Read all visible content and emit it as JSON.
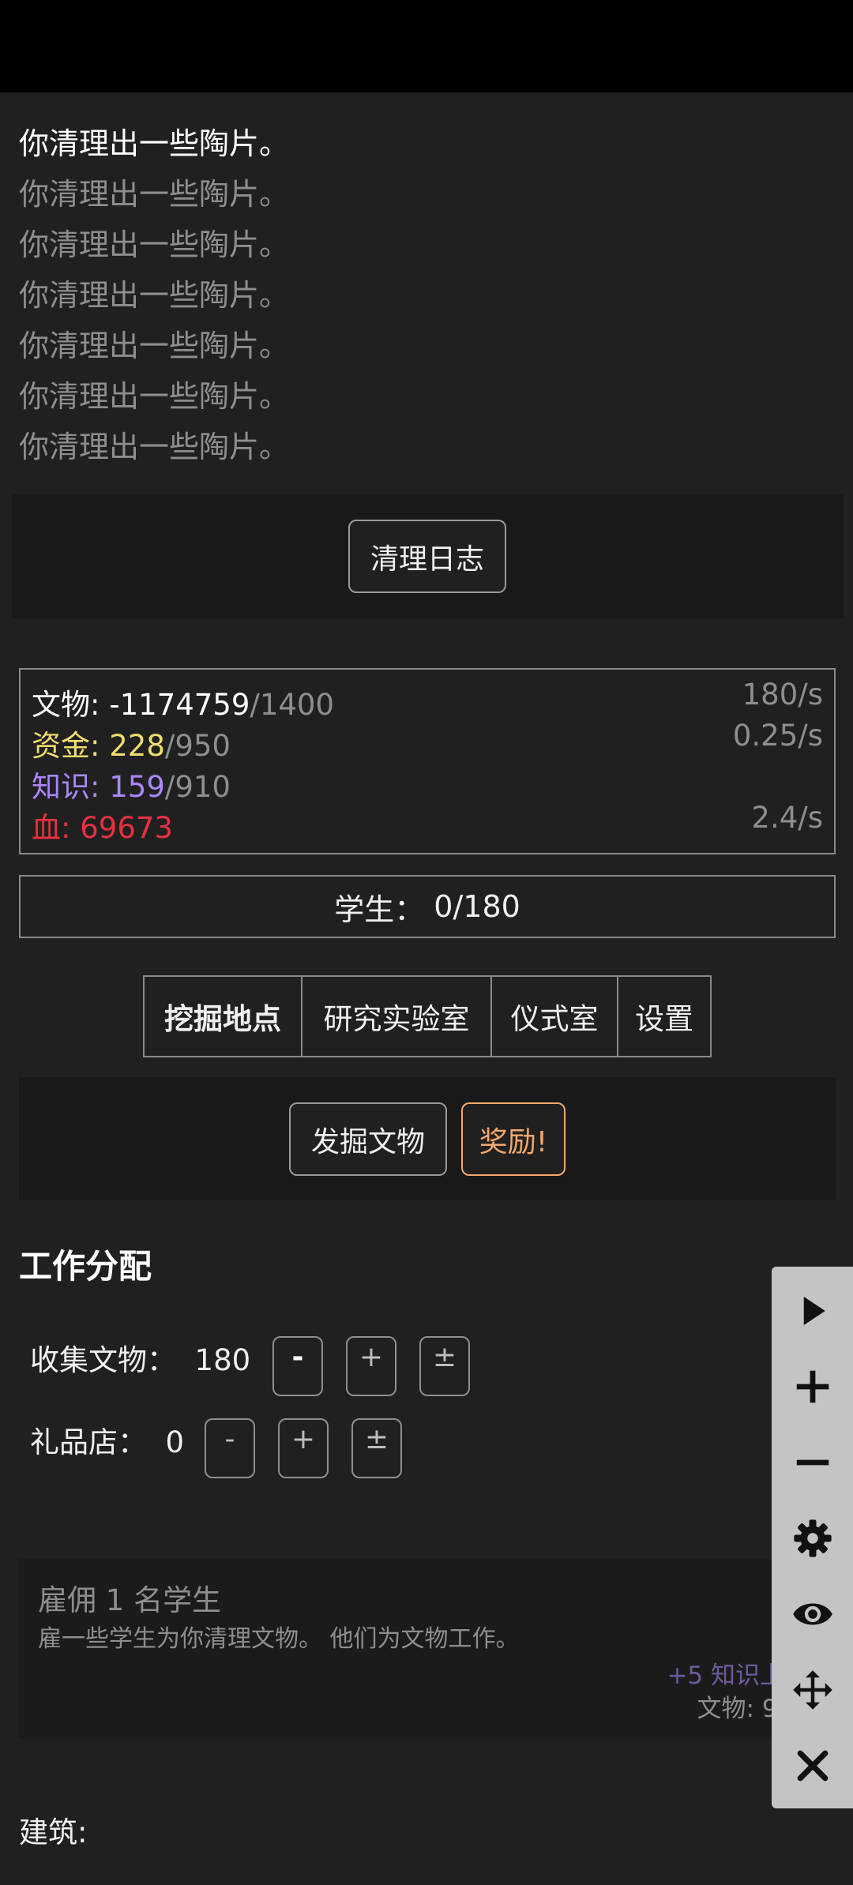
{
  "log": {
    "lines": [
      "你清理出一些陶片。",
      "你清理出一些陶片。",
      "你清理出一些陶片。",
      "你清理出一些陶片。",
      "你清理出一些陶片。",
      "你清理出一些陶片。",
      "你清理出一些陶片。"
    ],
    "clear_button": "清理日志"
  },
  "resources": [
    {
      "label": "文物: ",
      "value": "-1174759",
      "max": "/1400",
      "rate": "180/s",
      "color": "#ffffff"
    },
    {
      "label": "资金: ",
      "value": "228",
      "max": "/950",
      "rate": "0.25/s",
      "color": "#f2de6c"
    },
    {
      "label": "知识: ",
      "value": "159",
      "max": "/910",
      "rate": "",
      "color": "#a987f7"
    },
    {
      "label": "血: ",
      "value": "69673",
      "max": "",
      "rate": "2.4/s",
      "color": "#e8313f"
    }
  ],
  "students": {
    "label": "学生：",
    "value": "0/180"
  },
  "tabs": [
    "挖掘地点",
    "研究实验室",
    "仪式室",
    "设置"
  ],
  "actions": {
    "dig": "发掘文物",
    "reward": "奖励!"
  },
  "work": {
    "title": "工作分配",
    "rows": [
      {
        "label": "收集文物：",
        "value": "180"
      },
      {
        "label": "礼品店：",
        "value": "0"
      }
    ],
    "minus": "-",
    "plus": "+",
    "plusminus": "±"
  },
  "hire_card": {
    "title": "雇佣 1 名学生",
    "desc": "雇一些学生为你清理文物。 他们为文物工作。",
    "effect": "+5 知识上限",
    "cost": "文物: 910"
  },
  "buildings": {
    "label": "建筑:"
  },
  "colors": {
    "accent_reward": "#f4a86a",
    "knowledge": "#a987f7",
    "funds": "#f2de6c",
    "blood": "#e8313f"
  },
  "floating_toolbar": {
    "icons": [
      "play-icon",
      "plus-icon",
      "minus-icon",
      "gear-icon",
      "eye-icon",
      "move-icon",
      "close-icon"
    ]
  }
}
